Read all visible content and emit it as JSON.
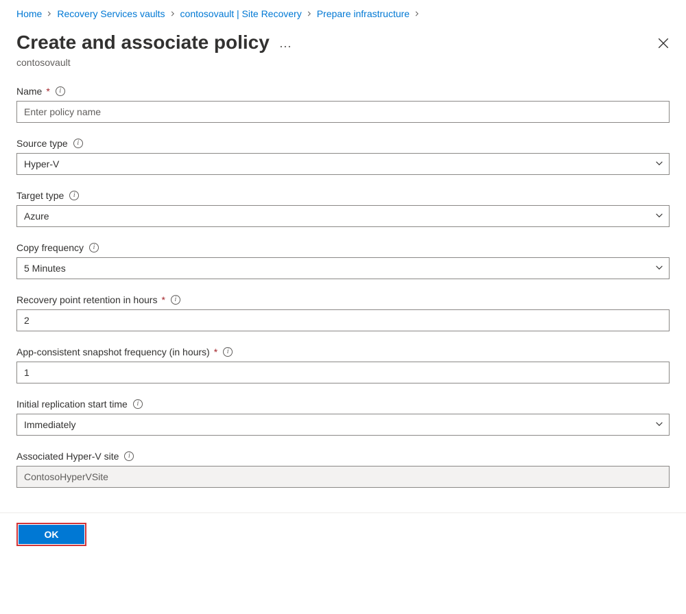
{
  "breadcrumb": {
    "items": [
      {
        "label": "Home"
      },
      {
        "label": "Recovery Services vaults"
      },
      {
        "label": "contosovault | Site Recovery"
      },
      {
        "label": "Prepare infrastructure"
      }
    ]
  },
  "header": {
    "title": "Create and associate policy",
    "subtitle": "contosovault"
  },
  "fields": {
    "name": {
      "label": "Name",
      "required": true,
      "placeholder": "Enter policy name",
      "value": ""
    },
    "source_type": {
      "label": "Source type",
      "required": false,
      "value": "Hyper-V"
    },
    "target_type": {
      "label": "Target type",
      "required": false,
      "value": "Azure"
    },
    "copy_frequency": {
      "label": "Copy frequency",
      "required": false,
      "value": "5 Minutes"
    },
    "retention_hours": {
      "label": "Recovery point retention in hours",
      "required": true,
      "value": "2"
    },
    "snapshot_frequency": {
      "label": "App-consistent snapshot frequency (in hours)",
      "required": true,
      "value": "1"
    },
    "initial_replication": {
      "label": "Initial replication start time",
      "required": false,
      "value": "Immediately"
    },
    "associated_site": {
      "label": "Associated Hyper-V site",
      "required": false,
      "value": "ContosoHyperVSite"
    }
  },
  "footer": {
    "ok_label": "OK"
  }
}
